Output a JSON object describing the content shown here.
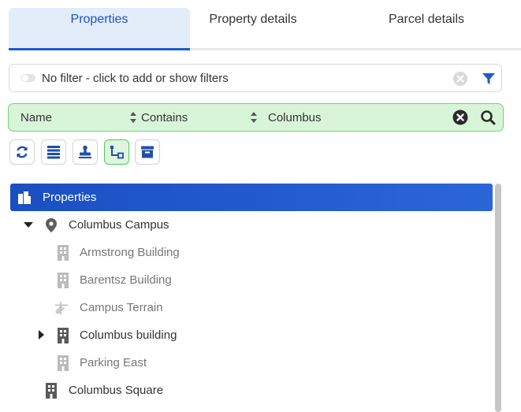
{
  "tabs": [
    {
      "label": "Properties"
    },
    {
      "label": "Property details"
    },
    {
      "label": "Parcel details"
    }
  ],
  "filter": {
    "text": "No filter - click to add or show filters"
  },
  "search": {
    "field": "Name",
    "operator": "Contains",
    "value": "Columbus"
  },
  "toolbar": [
    "refresh-icon",
    "list-icon",
    "stamp-icon",
    "hierarchy-icon",
    "archive-icon"
  ],
  "colors": {
    "accent": "#1f5bc6",
    "search_bg": "#d9f5d9",
    "search_border": "#72d572"
  },
  "tree": {
    "root": {
      "label": "Properties"
    },
    "items": [
      {
        "label": "Columbus Campus"
      },
      {
        "label": "Armstrong Building"
      },
      {
        "label": "Barentsz Building"
      },
      {
        "label": "Campus Terrain"
      },
      {
        "label": "Columbus building"
      },
      {
        "label": "Parking East"
      },
      {
        "label": "Columbus Square"
      }
    ]
  }
}
